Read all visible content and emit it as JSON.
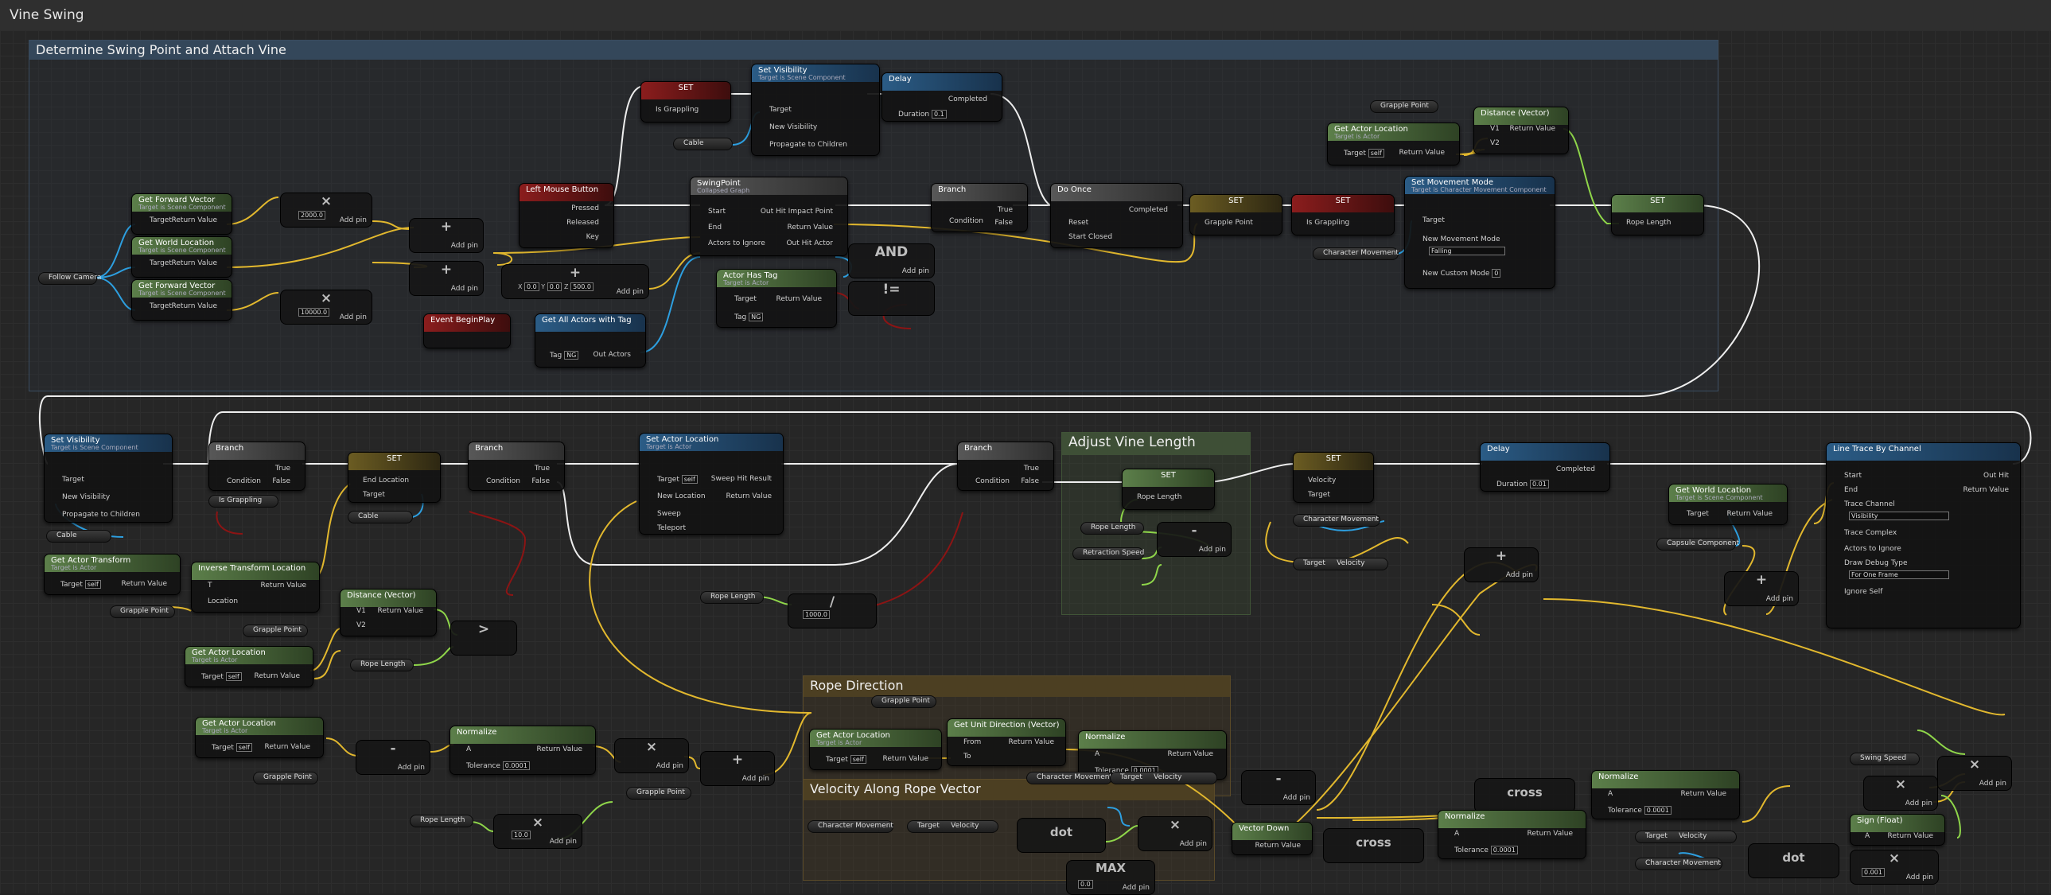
{
  "window": {
    "title": "Vine Swing"
  },
  "comments": {
    "c1": "Determine Swing Point and Attach Vine",
    "c2": "Adjust Vine Length",
    "c3": "Rope Direction",
    "c4": "Velocity Along Rope Vector"
  },
  "labels": {
    "target_scene": "Target is Scene Component",
    "target_actor": "Target is Actor",
    "target_charmove": "Target is Character Movement Component",
    "collapsed": "Collapsed Graph",
    "target": "Target",
    "return_value": "Return Value",
    "add_pin": "Add pin",
    "completed": "Completed",
    "duration": "Duration",
    "condition": "Condition",
    "true": "True",
    "false": "False",
    "self": "self"
  },
  "vars": {
    "follow_camera": "Follow Camera",
    "cable": "Cable",
    "grapple_point": "Grapple Point",
    "character_movement": "Character Movement",
    "rope_length": "Rope Length",
    "retraction_speed": "Retraction Speed",
    "is_grappling": "Is Grappling",
    "capsule_component": "Capsule Component",
    "swing_speed": "Swing Speed",
    "velocity": "Velocity"
  },
  "nodes": {
    "get_forward_vector": "Get Forward Vector",
    "get_world_location": "Get World Location",
    "left_mouse_button": "Left Mouse Button",
    "lmb_pressed": "Pressed",
    "lmb_released": "Released",
    "lmb_key": "Key",
    "event_beginplay": "Event BeginPlay",
    "get_all_actors_with_tag": "Get All Actors with Tag",
    "tag": "Tag",
    "tag_value": "NG",
    "out_actors": "Out Actors",
    "set": "SET",
    "set_visibility": "Set Visibility",
    "new_visibility": "New Visibility",
    "propagate": "Propagate to Children",
    "delay": "Delay",
    "delay1_val": "0.1",
    "delay2_val": "0.01",
    "swingpoint": "SwingPoint",
    "start": "Start",
    "end": "End",
    "actors_to_ignore": "Actors to Ignore",
    "out_hit_impact": "Out Hit Impact Point",
    "out_hit_actor": "Out Hit Actor",
    "actor_has_tag": "Actor Has Tag",
    "and": "AND",
    "branch": "Branch",
    "do_once": "Do Once",
    "reset": "Reset",
    "start_closed": "Start Closed",
    "get_actor_location": "Get Actor Location",
    "distance_vector": "Distance (Vector)",
    "v1": "V1",
    "v2": "V2",
    "set_movement_mode": "Set Movement Mode",
    "new_movement_mode": "New Movement Mode",
    "falling": "Falling",
    "new_custom_mode": "New Custom Mode",
    "custom_mode_val": "0",
    "mul_2000": "2000.0",
    "mul_10000": "10000.0",
    "vec_x": "0.0",
    "vec_y": "0.0",
    "vec_z": "500.0",
    "get_actor_transform": "Get Actor Transform",
    "inverse_transform_location": "Inverse Transform Location",
    "t": "T",
    "location": "Location",
    "end_location": "End Location",
    "set_actor_location": "Set Actor Location",
    "new_location": "New Location",
    "sweep": "Sweep",
    "teleport": "Teleport",
    "sweep_hit": "Sweep Hit Result",
    "div_1000": "1000.0",
    "line_trace": "Line Trace By Channel",
    "out_hit": "Out Hit",
    "trace_channel": "Trace Channel",
    "visibility": "Visibility",
    "trace_complex": "Trace Complex",
    "draw_debug": "Draw Debug Type",
    "for_one_frame": "For One Frame",
    "ignore_self": "Ignore Self",
    "normalize": "Normalize",
    "tolerance": "Tolerance",
    "tol_val": "0.0001",
    "a": "A",
    "mul_10": "10.0",
    "get_unit_direction": "Get Unit Direction (Vector)",
    "from": "From",
    "to": "To",
    "dot": "dot",
    "cross": "cross",
    "max": "MAX",
    "max_val": "0.0",
    "vector_down": "Vector Down",
    "sign_float": "Sign (Float)",
    "mul_0001": "0.001",
    "get_world_location2": "Get World Location"
  }
}
